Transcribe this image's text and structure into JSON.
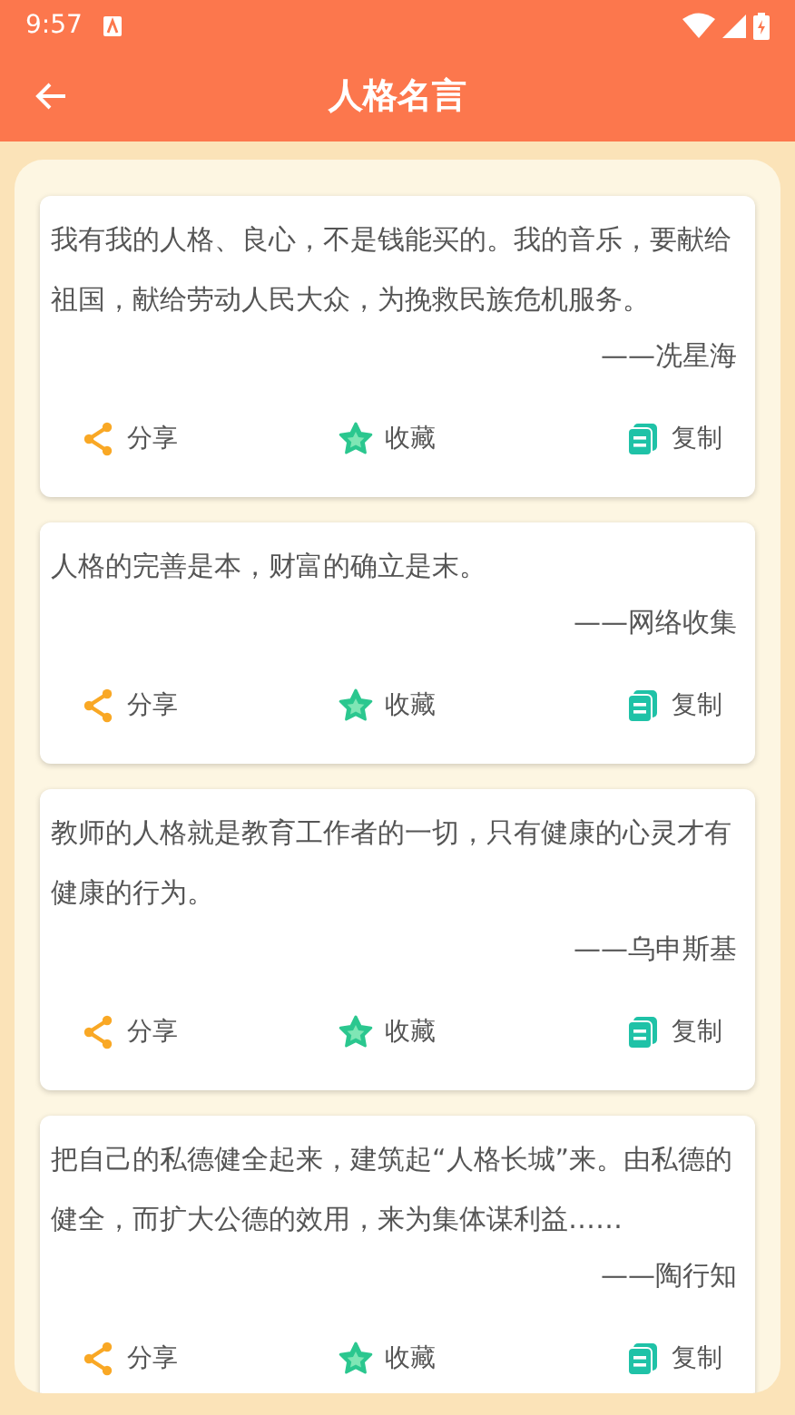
{
  "status_bar": {
    "time": "9:57"
  },
  "app_bar": {
    "title": "人格名言"
  },
  "quotes": [
    {
      "text": "我有我的人格、良心，不是钱能买的。我的音乐，要献给祖国，献给劳动人民大众，为挽救民族危机服务。",
      "author": "——冼星海",
      "actions": [
        {
          "kind": "share",
          "label": "分享"
        },
        {
          "kind": "favorite",
          "label": "收藏"
        },
        {
          "kind": "copy",
          "label": "复制"
        }
      ]
    },
    {
      "text": "人格的完善是本，财富的确立是末。",
      "author": "——网络收集",
      "actions": [
        {
          "kind": "share",
          "label": "分享"
        },
        {
          "kind": "favorite",
          "label": "收藏"
        },
        {
          "kind": "copy",
          "label": "复制"
        }
      ]
    },
    {
      "text": "教师的人格就是教育工作者的一切，只有健康的心灵才有健康的行为。",
      "author": "——乌申斯基",
      "actions": [
        {
          "kind": "share",
          "label": "分享"
        },
        {
          "kind": "favorite",
          "label": "收藏"
        },
        {
          "kind": "copy",
          "label": "复制"
        }
      ]
    },
    {
      "text": "把自己的私德健全起来，建筑起“人格长城”来。由私德的健全，而扩大公德的效用，来为集体谋利益……",
      "author": "——陶行知",
      "actions": [
        {
          "kind": "share",
          "label": "分享"
        },
        {
          "kind": "favorite",
          "label": "收藏"
        },
        {
          "kind": "copy",
          "label": "复制"
        }
      ]
    }
  ]
}
